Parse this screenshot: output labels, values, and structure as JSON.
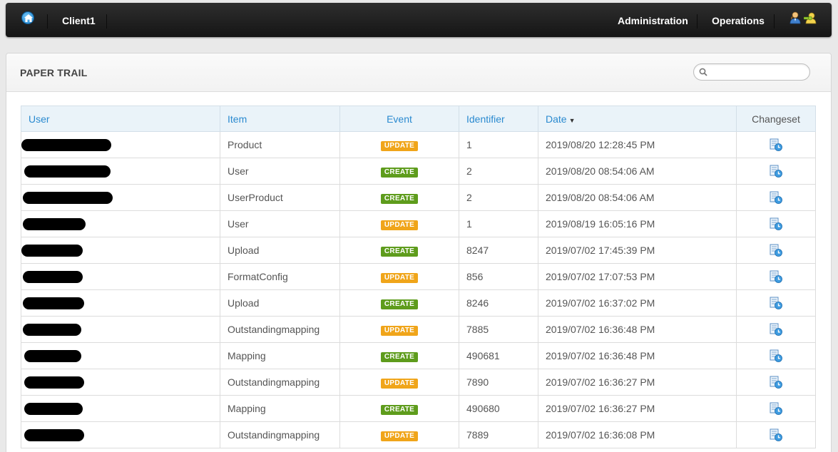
{
  "topbar": {
    "client": "Client1",
    "nav": [
      "Administration",
      "Operations"
    ]
  },
  "panel": {
    "title": "PAPER TRAIL",
    "search_placeholder": ""
  },
  "table": {
    "headers": {
      "user": "User",
      "item": "Item",
      "event": "Event",
      "identifier": "Identifier",
      "date": "Date",
      "date_sort": "▼",
      "changeset": "Changeset"
    },
    "rows": [
      {
        "item": "Product",
        "event": "UPDATE",
        "identifier": "1",
        "date": "2019/08/20 12:28:45 PM"
      },
      {
        "item": "User",
        "event": "CREATE",
        "identifier": "2",
        "date": "2019/08/20 08:54:06 AM"
      },
      {
        "item": "UserProduct",
        "event": "CREATE",
        "identifier": "2",
        "date": "2019/08/20 08:54:06 AM"
      },
      {
        "item": "User",
        "event": "UPDATE",
        "identifier": "1",
        "date": "2019/08/19 16:05:16 PM"
      },
      {
        "item": "Upload",
        "event": "CREATE",
        "identifier": "8247",
        "date": "2019/07/02 17:45:39 PM"
      },
      {
        "item": "FormatConfig",
        "event": "UPDATE",
        "identifier": "856",
        "date": "2019/07/02 17:07:53 PM"
      },
      {
        "item": "Upload",
        "event": "CREATE",
        "identifier": "8246",
        "date": "2019/07/02 16:37:02 PM"
      },
      {
        "item": "Outstandingmapping",
        "event": "UPDATE",
        "identifier": "7885",
        "date": "2019/07/02 16:36:48 PM"
      },
      {
        "item": "Mapping",
        "event": "CREATE",
        "identifier": "490681",
        "date": "2019/07/02 16:36:48 PM"
      },
      {
        "item": "Outstandingmapping",
        "event": "UPDATE",
        "identifier": "7890",
        "date": "2019/07/02 16:36:27 PM"
      },
      {
        "item": "Mapping",
        "event": "CREATE",
        "identifier": "490680",
        "date": "2019/07/02 16:36:27 PM"
      },
      {
        "item": "Outstandingmapping",
        "event": "UPDATE",
        "identifier": "7889",
        "date": "2019/07/02 16:36:08 PM"
      }
    ]
  },
  "colors": {
    "update": "#f0a51a",
    "create": "#5e9c1c",
    "link": "#2a8ad0"
  },
  "icons": {
    "home": "home-icon",
    "user": "user-icon",
    "key": "key-icon",
    "search": "search-icon",
    "changeset": "changeset-icon"
  }
}
